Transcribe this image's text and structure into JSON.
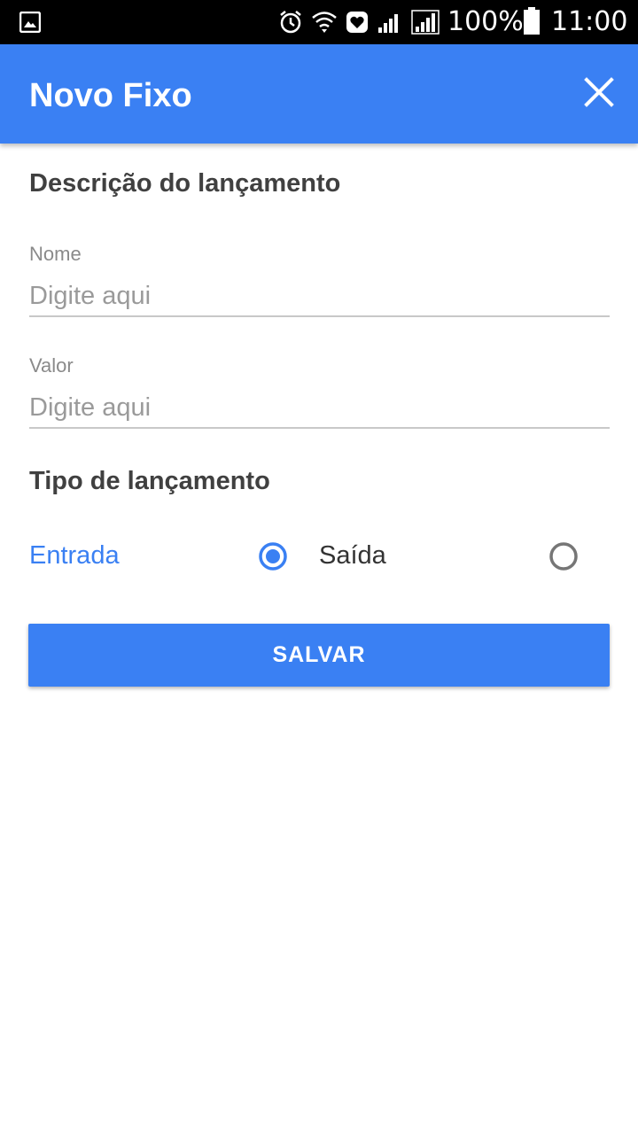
{
  "status_bar": {
    "battery": "100%",
    "time": "11:00",
    "icons": [
      "gallery-icon",
      "alarm-icon",
      "wifi-icon",
      "heart-icon",
      "signal-icon",
      "signal-icon",
      "battery-icon"
    ]
  },
  "app_bar": {
    "title": "Novo Fixo",
    "close_icon": "close-icon",
    "color": "#3a80f3"
  },
  "form": {
    "section_description": "Descrição do lançamento",
    "name_label": "Nome",
    "name_placeholder": "Digite aqui",
    "name_value": "",
    "value_label": "Valor",
    "value_placeholder": "Digite aqui",
    "value_value": "",
    "section_type": "Tipo de lançamento",
    "options": [
      {
        "label": "Entrada",
        "selected": true
      },
      {
        "label": "Saída",
        "selected": false
      }
    ]
  },
  "actions": {
    "save_label": "SALVAR"
  },
  "colors": {
    "accent": "#3a80f3",
    "text_dark": "#404040",
    "text_hint": "#8a8a8a"
  }
}
